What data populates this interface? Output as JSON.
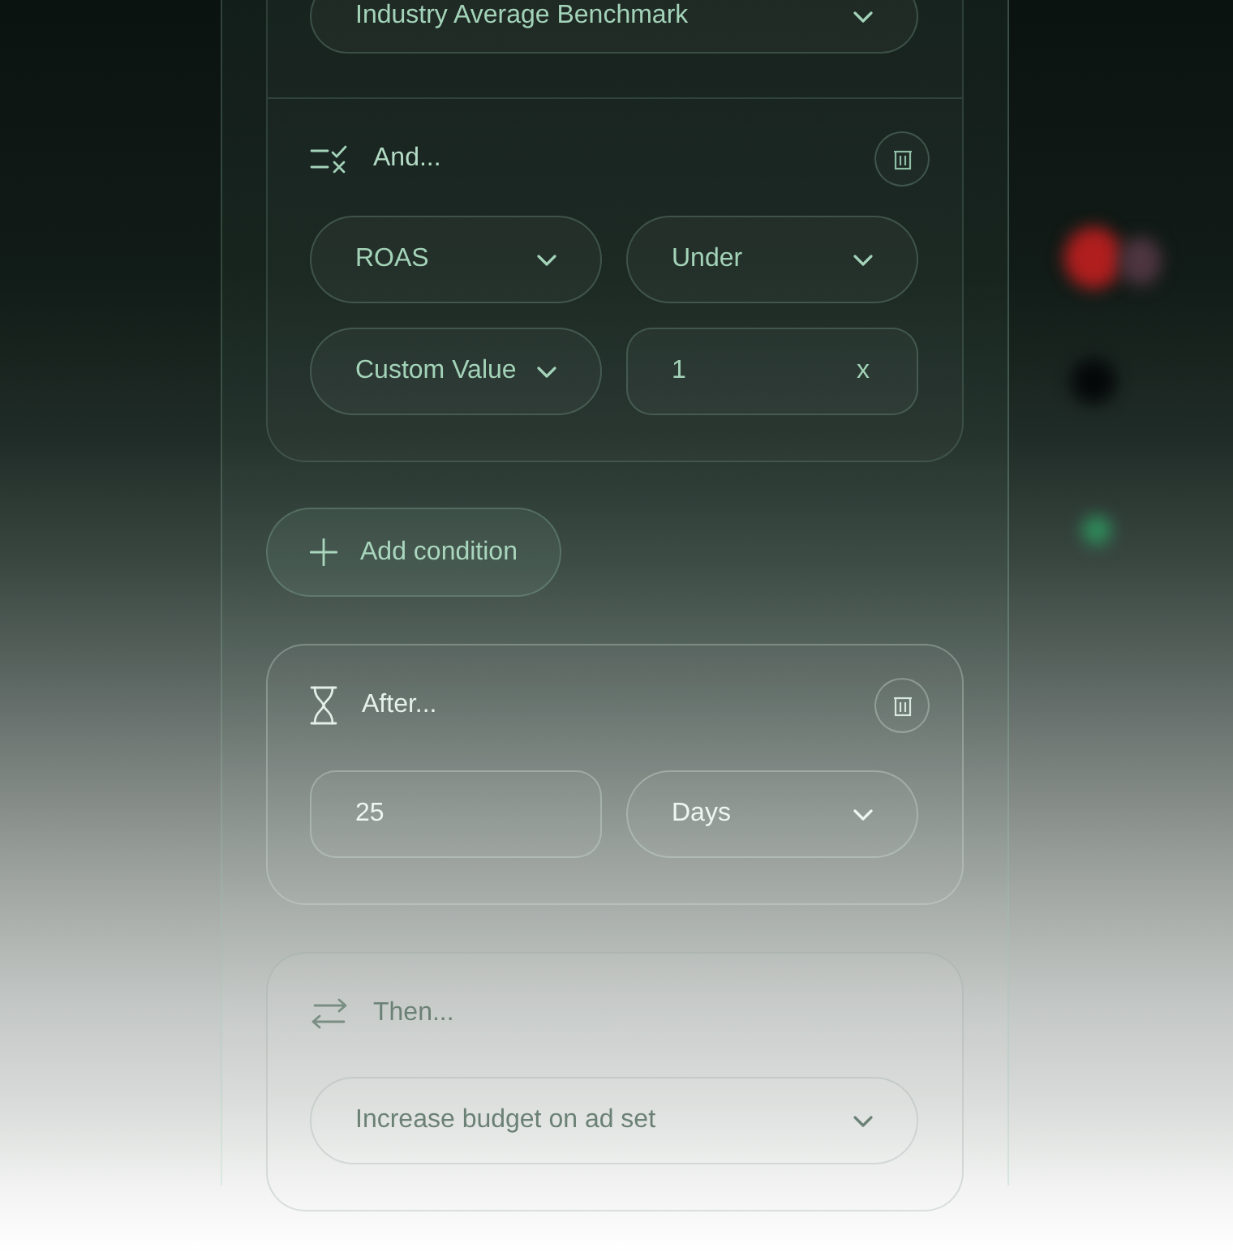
{
  "blocks": [
    {
      "kind": "benchmark",
      "rows": [
        [
          {
            "kind": "select",
            "value": "Industry Average Benchmark"
          }
        ]
      ]
    },
    {
      "kind": "condition",
      "title": "And...",
      "rows": [
        [
          {
            "kind": "select",
            "value": "ROAS"
          },
          {
            "kind": "select",
            "value": "Under"
          }
        ],
        [
          {
            "kind": "select",
            "value": "Custom Value"
          },
          {
            "kind": "input",
            "value": "1",
            "suffix": "x"
          }
        ]
      ]
    },
    {
      "kind": "add",
      "label": "Add condition"
    },
    {
      "kind": "delay",
      "title": "After...",
      "rows": [
        [
          {
            "kind": "input",
            "value": "25"
          },
          {
            "kind": "select",
            "value": "Days"
          }
        ]
      ]
    },
    {
      "kind": "action",
      "title": "Then...",
      "rows": [
        [
          {
            "kind": "select",
            "value": "Increase budget on ad set"
          }
        ]
      ]
    }
  ]
}
